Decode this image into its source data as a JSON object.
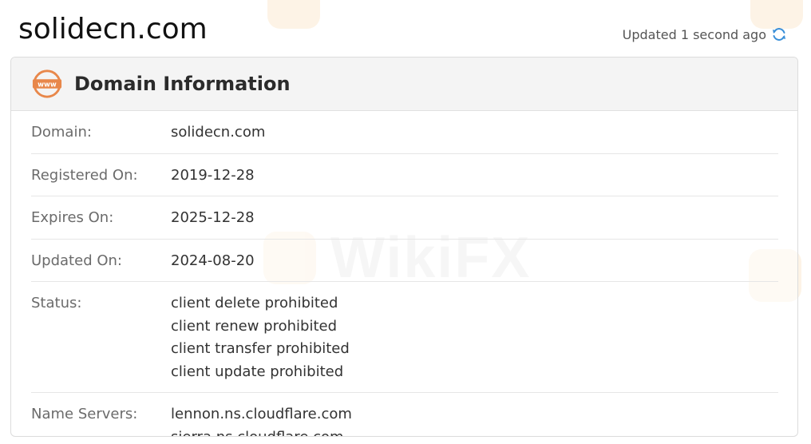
{
  "page": {
    "title": "solidecn.com",
    "updated_text": "Updated 1 second ago"
  },
  "card": {
    "title": "Domain Information",
    "icon_text": "www",
    "rows": [
      {
        "label": "Domain:",
        "values": [
          "solidecn.com"
        ]
      },
      {
        "label": "Registered On:",
        "values": [
          "2019-12-28"
        ]
      },
      {
        "label": "Expires On:",
        "values": [
          "2025-12-28"
        ]
      },
      {
        "label": "Updated On:",
        "values": [
          "2024-08-20"
        ]
      },
      {
        "label": "Status:",
        "values": [
          "client delete prohibited",
          "client renew prohibited",
          "client transfer prohibited",
          "client update prohibited"
        ]
      },
      {
        "label": "Name Servers:",
        "values": [
          "lennon.ns.cloudflare.com",
          "sierra.ns.cloudflare.com"
        ]
      }
    ]
  },
  "watermark": {
    "text": "WikiFX"
  },
  "colors": {
    "accent": "#e8874a",
    "refresh": "#3a8fd8",
    "header_bg": "#f4f4f4"
  },
  "icons": {
    "header": "www-globe-icon",
    "refresh": "refresh-icon"
  }
}
